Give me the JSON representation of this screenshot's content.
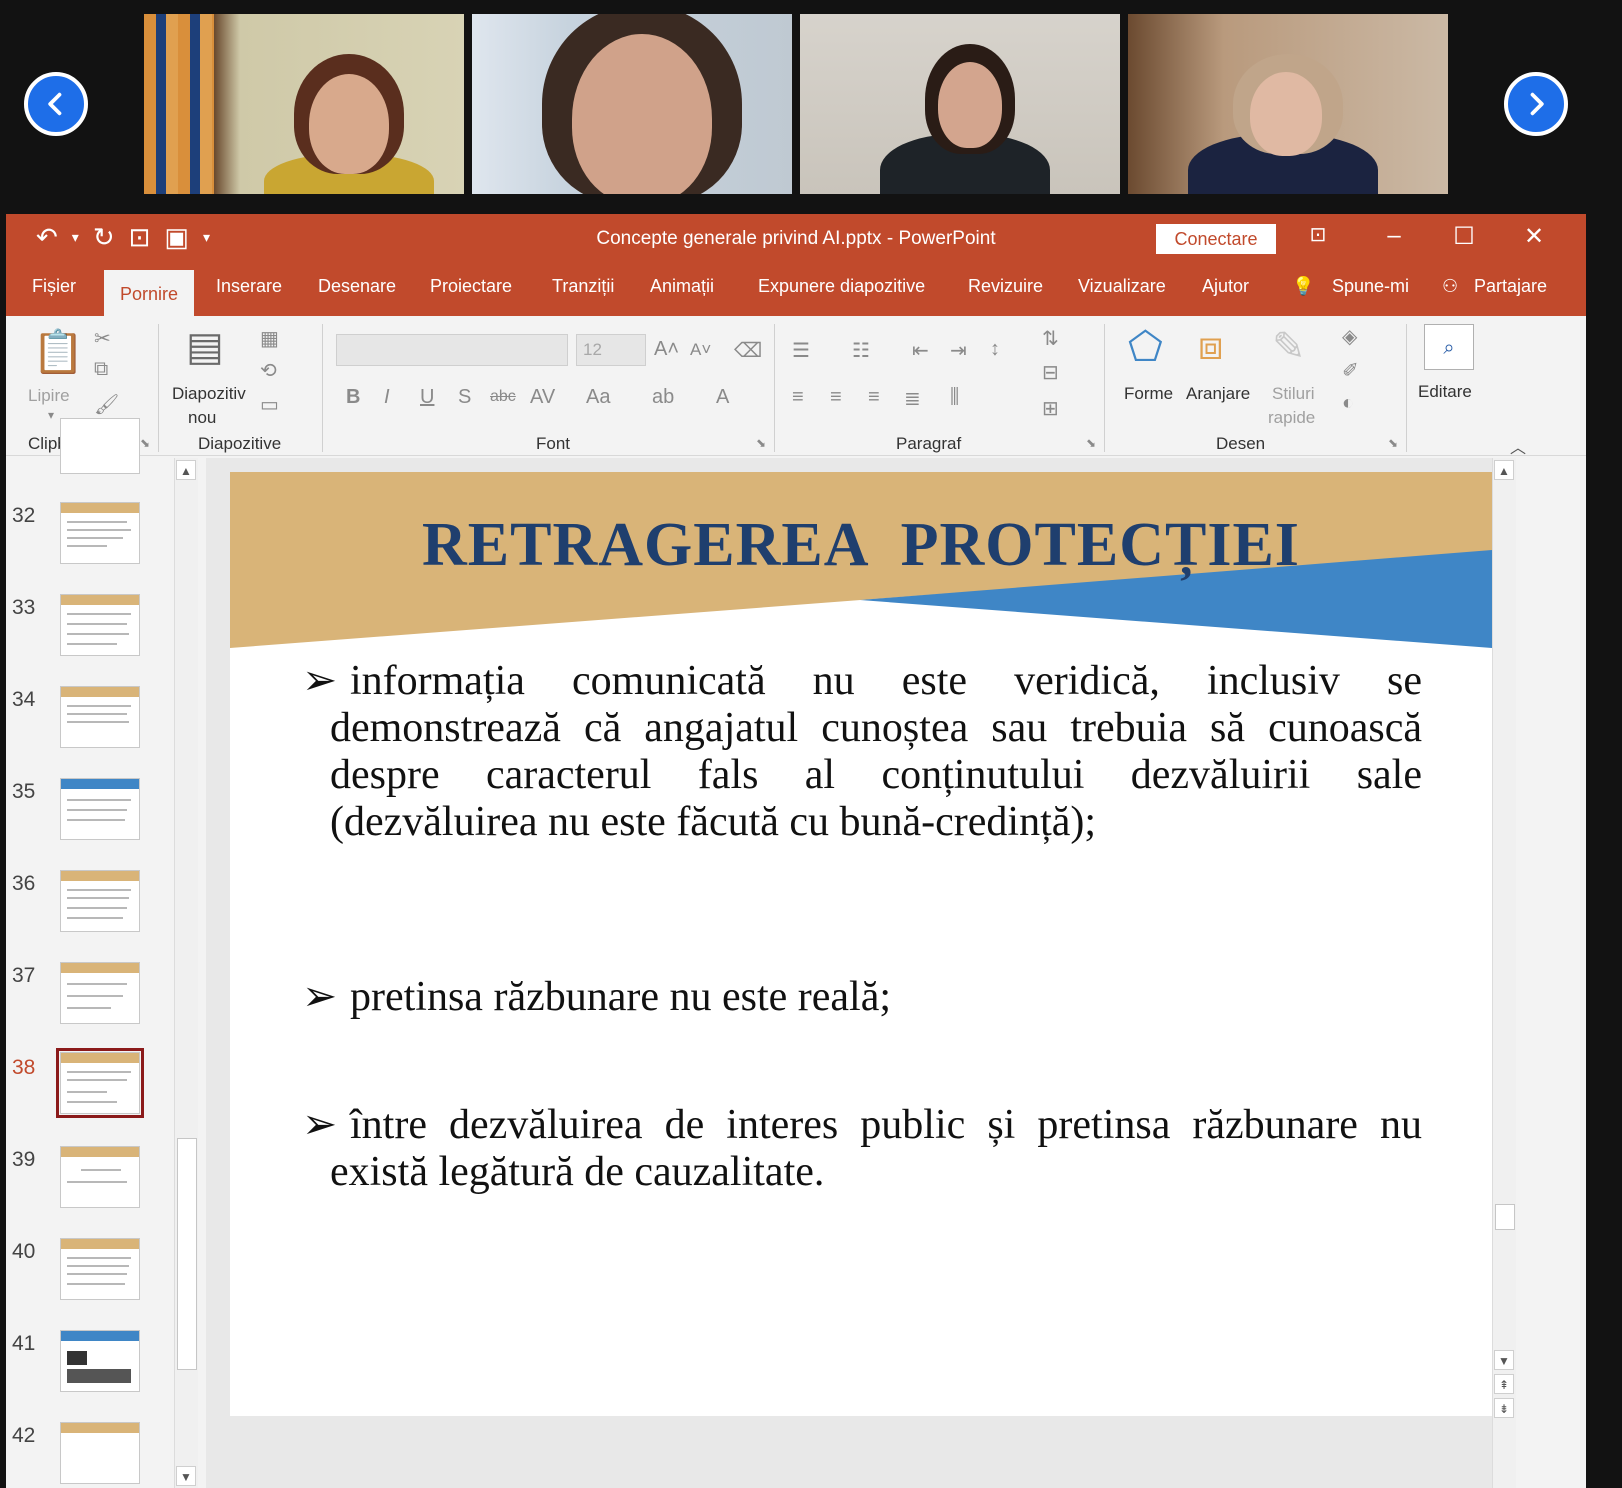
{
  "window": {
    "title": "Concepte generale privind AI.pptx  -  PowerPoint",
    "connect_label": "Conectare"
  },
  "tabs": [
    "Fișier",
    "Pornire",
    "Inserare",
    "Desenare",
    "Proiectare",
    "Tranziții",
    "Animații",
    "Expunere diapozitive",
    "Revizuire",
    "Vizualizare",
    "Ajutor",
    "Spune-mi",
    "Partajare"
  ],
  "ribbon": {
    "paste_label": "Lipire",
    "new_slide_label_1": "Diapozitiv",
    "new_slide_label_2": "nou",
    "font_size": "12",
    "shapes_label": "Forme",
    "arrange_label": "Aranjare",
    "quick_styles_label_1": "Stiluri",
    "quick_styles_label_2": "rapide",
    "editing_label": "Editare",
    "groups": {
      "clipboard": "Clipboard",
      "slides": "Diapozitive",
      "font": "Font",
      "paragraph": "Paragraf",
      "drawing": "Desen"
    }
  },
  "thumbnails": {
    "numbers": [
      "32",
      "33",
      "34",
      "35",
      "36",
      "37",
      "38",
      "39",
      "40",
      "41",
      "42"
    ],
    "selected": "38"
  },
  "slide": {
    "title": "RETRAGEREA PROTECȚIEI",
    "bullets": [
      "informația comunicată nu este veridică, inclusiv se demonstrează că angajatul cunoștea sau trebuia să cunoască despre caracterul fals al conținutului dezvăluirii sale (dezvăluirea nu este făcută cu bună-credință);",
      "pretinsa răzbunare nu este reală;",
      "între dezvăluirea de interes public și pretinsa răzbunare nu există legătură de cauzalitate."
    ],
    "colors": {
      "band": "#d9b478",
      "accent_blue": "#3f86c6",
      "title": "#1f3f6e"
    }
  },
  "video": {
    "participants": 4,
    "nav_prev_icon": "chevron-left-icon",
    "nav_next_icon": "chevron-right-icon"
  }
}
